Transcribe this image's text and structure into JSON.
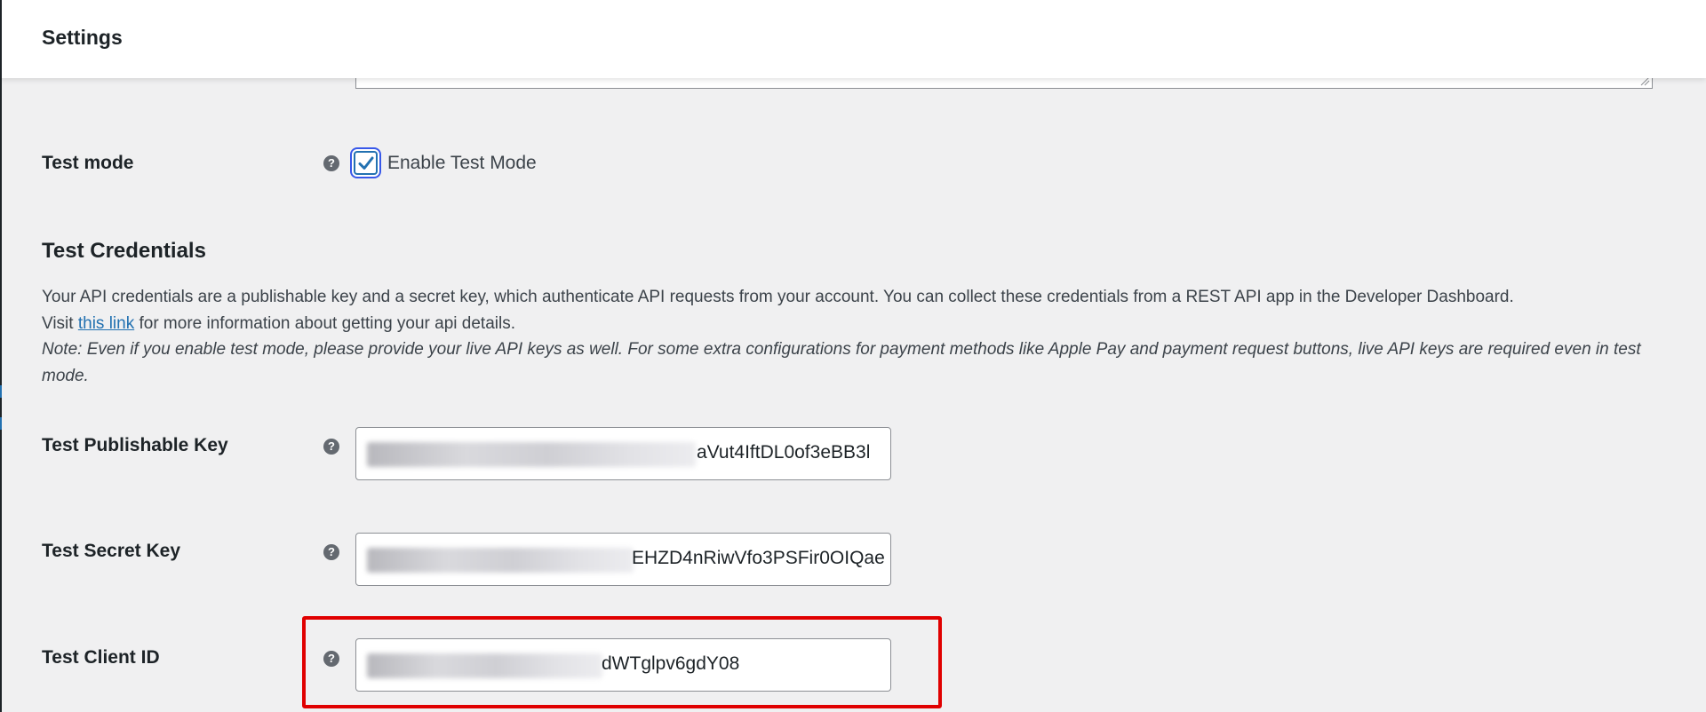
{
  "header": {
    "title": "Settings"
  },
  "test_mode": {
    "label": "Test mode",
    "help_icon": "question-circle-icon",
    "checkbox_checked": true,
    "checkbox_label": "Enable Test Mode"
  },
  "credentials": {
    "title": "Test Credentials",
    "description_line1": "Your API credentials are a publishable key and a secret key, which authenticate API requests from your account. You can collect these credentials from a REST API app in the Developer Dashboard.",
    "description_visit": "Visit",
    "link_text": "this link",
    "description_after_link": "for more information about getting your api details.",
    "note": "Note: Even if you enable test mode, please provide your live API keys as well. For some extra configurations for payment methods like Apple Pay and payment request buttons, live API keys are required even in test mode."
  },
  "fields": {
    "publishable": {
      "label": "Test Publishable Key",
      "visible_value": "aVut4IftDL0of3eBB3l"
    },
    "secret": {
      "label": "Test Secret Key",
      "visible_value": "EHZD4nRiwVfo3PSFir0OIQae"
    },
    "client_id": {
      "label": "Test Client ID",
      "visible_value": "dWTglpv6gdY08"
    }
  },
  "colors": {
    "highlight": "#e00000",
    "accent": "#2271b1",
    "background": "#f0f0f1"
  }
}
